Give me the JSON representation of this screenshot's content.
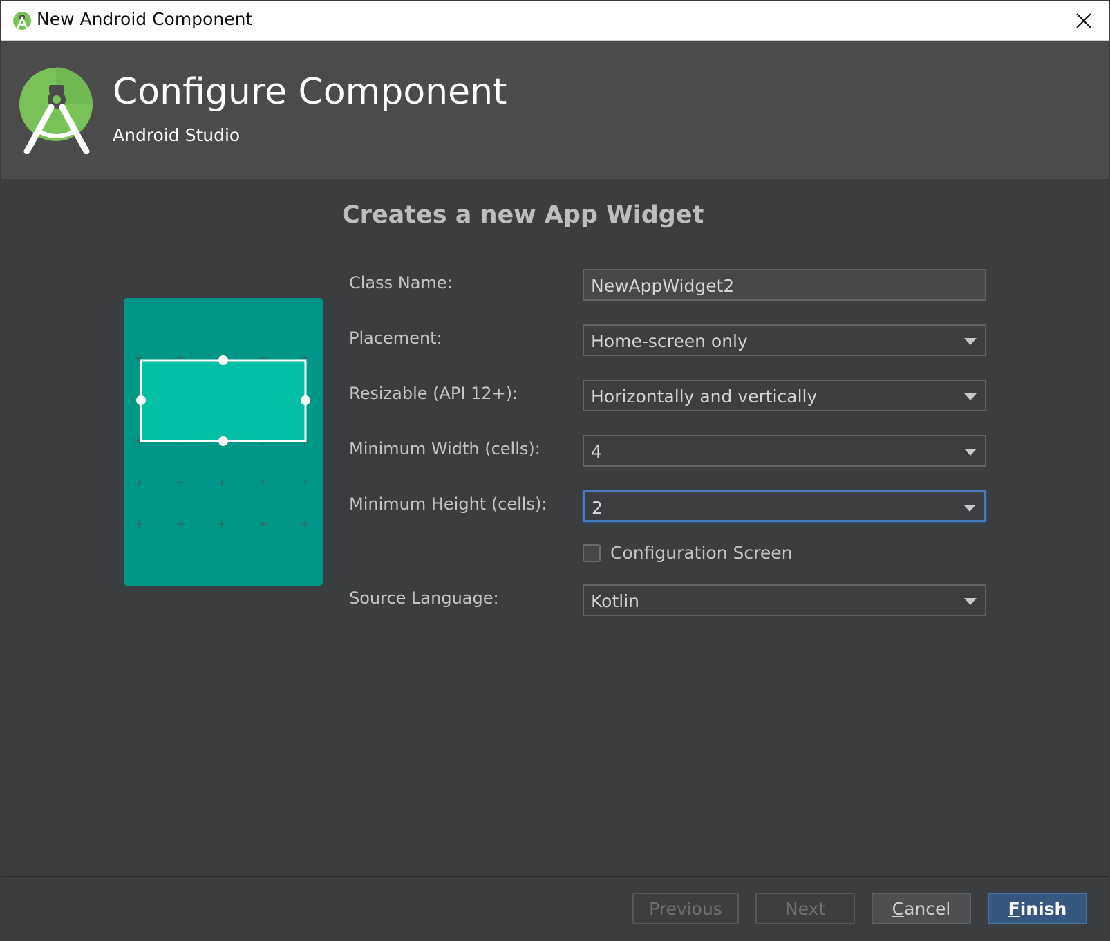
{
  "window": {
    "title": "New Android Component",
    "close_icon": "close-icon"
  },
  "header": {
    "title": "Configure Component",
    "subtitle": "Android Studio",
    "logo_icon": "android-studio-logo"
  },
  "content": {
    "title": "Creates a new App Widget",
    "preview_icon": "widget-preview-image",
    "accent": "#009688",
    "widget_color": "#00bfa5"
  },
  "form": {
    "class_name": {
      "label": "Class Name:",
      "value": "NewAppWidget2"
    },
    "placement": {
      "label": "Placement:",
      "value": "Home-screen only"
    },
    "resizable": {
      "label": "Resizable (API 12+):",
      "value": "Horizontally and vertically"
    },
    "min_width": {
      "label": "Minimum Width (cells):",
      "value": "4"
    },
    "min_height": {
      "label": "Minimum Height (cells):",
      "value": "2"
    },
    "config_screen": {
      "label": "Configuration Screen",
      "checked": false
    },
    "source_language": {
      "label": "Source Language:",
      "value": "Kotlin"
    }
  },
  "buttons": {
    "previous": {
      "label": "Previous",
      "enabled": false
    },
    "next": {
      "label": "Next",
      "enabled": false
    },
    "cancel": {
      "label_mnemonic": "C",
      "label_rest": "ancel",
      "enabled": true
    },
    "finish": {
      "label_mnemonic": "F",
      "label_rest": "inish",
      "enabled": true
    }
  }
}
